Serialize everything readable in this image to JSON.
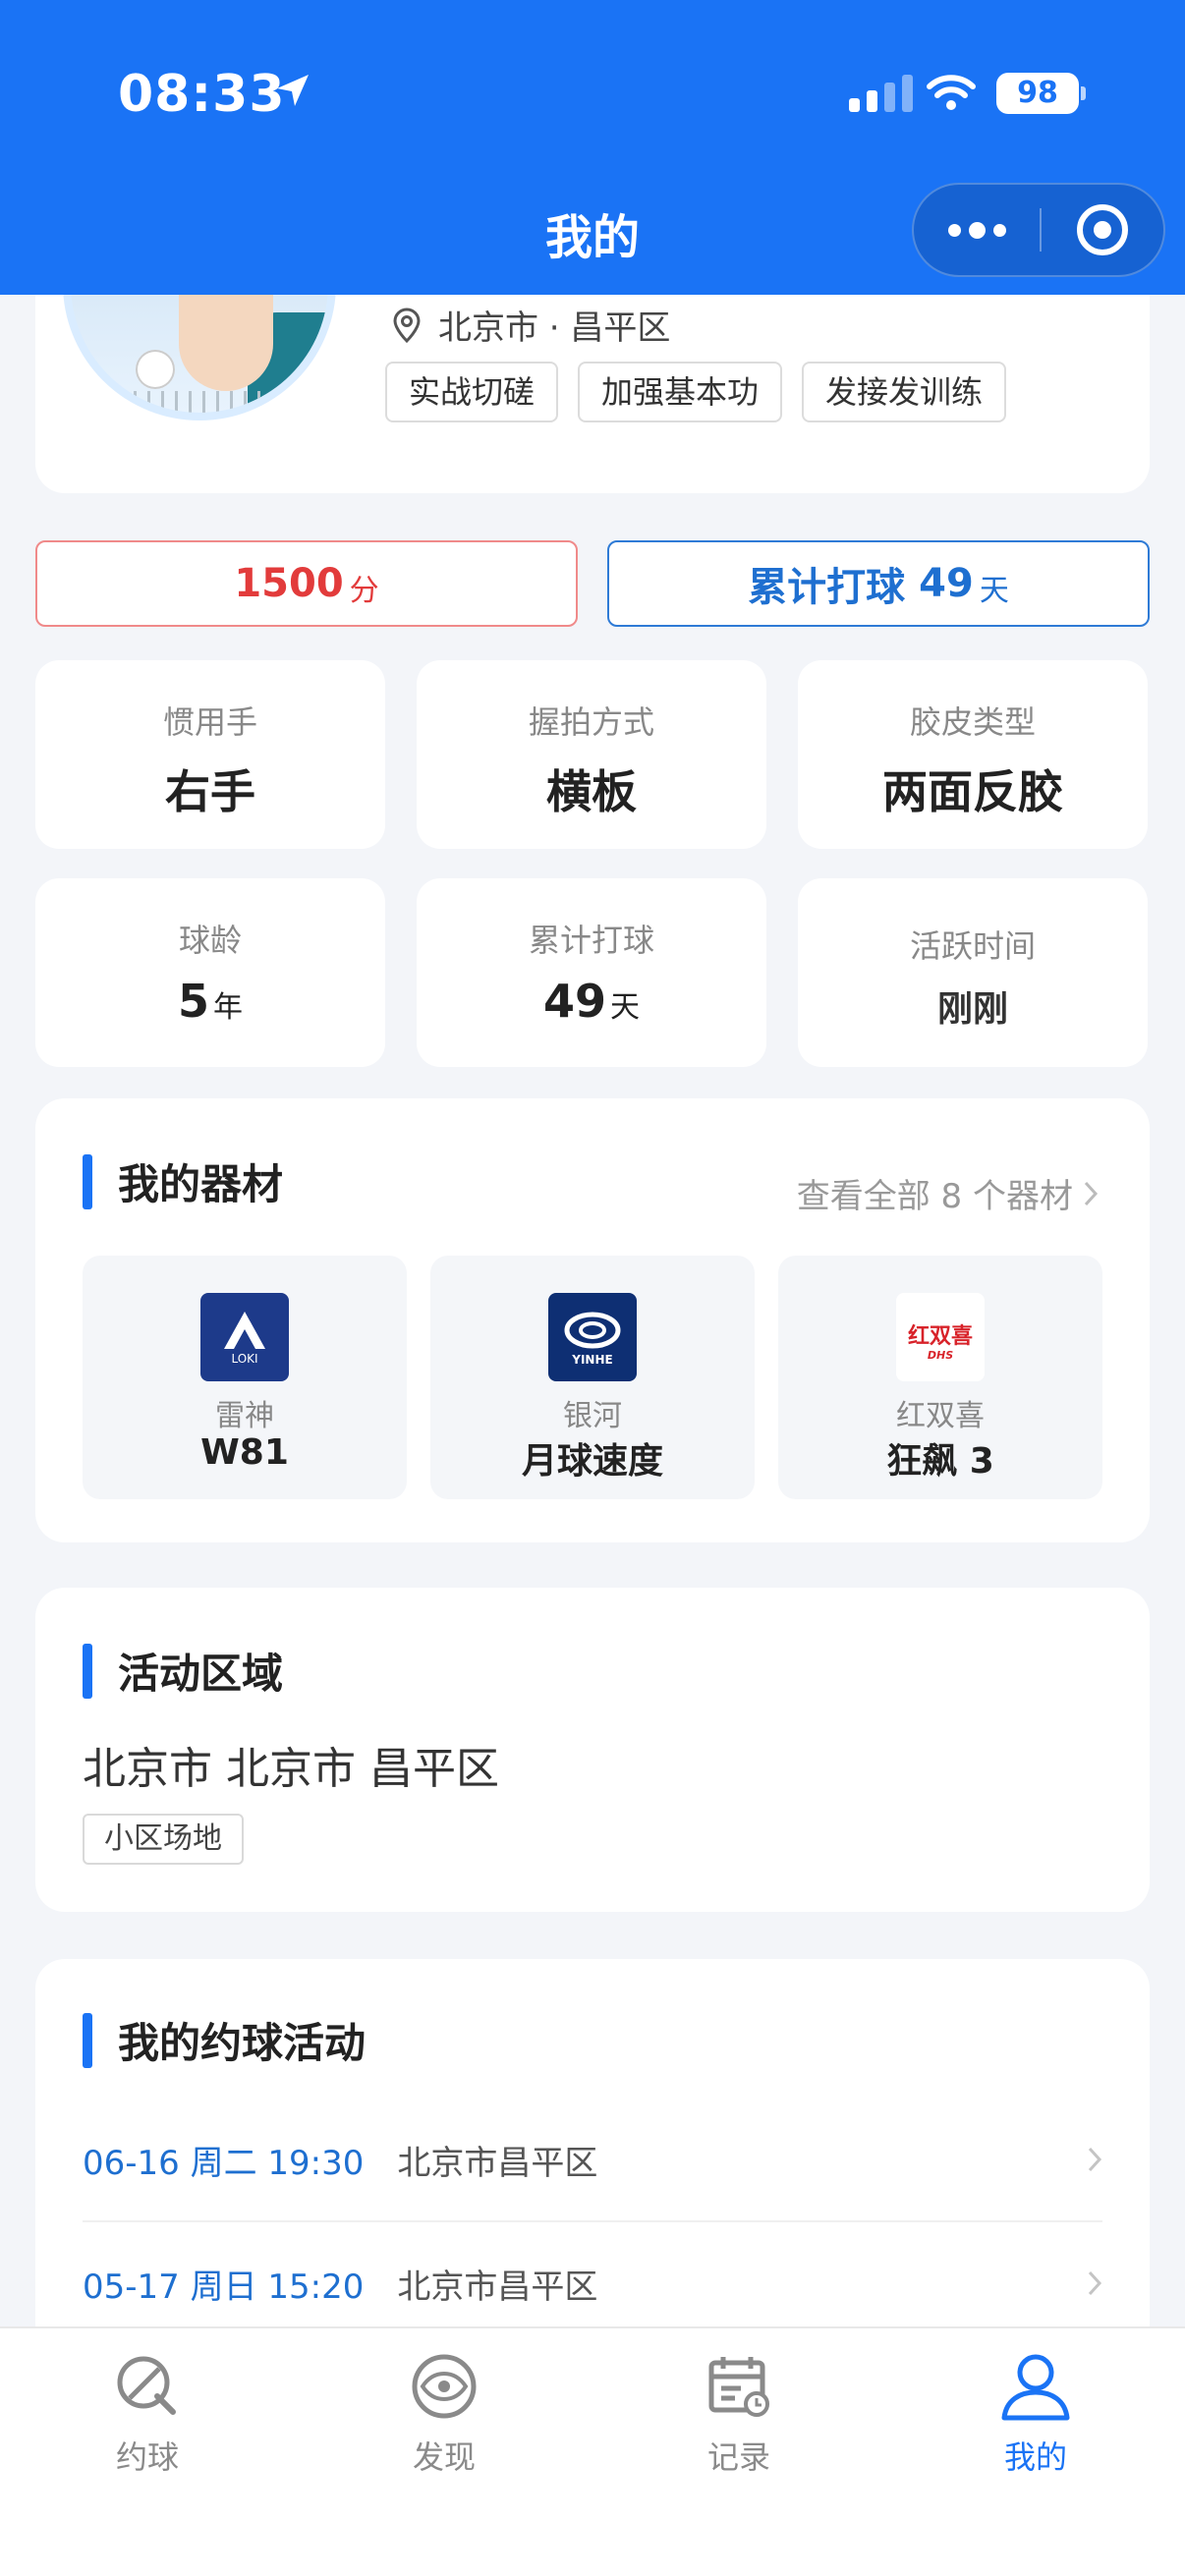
{
  "status_bar": {
    "time": "08:33",
    "battery": "98"
  },
  "header": {
    "title": "我的"
  },
  "profile": {
    "location": "北京市 · 昌平区",
    "tags": [
      "实战切磋",
      "加强基本功",
      "发接发训练"
    ]
  },
  "score": {
    "value": "1500",
    "unit": "分"
  },
  "total_days": {
    "label": "累计打球",
    "value": "49",
    "unit": "天"
  },
  "stats": {
    "hand": {
      "label": "惯用手",
      "value": "右手"
    },
    "grip": {
      "label": "握拍方式",
      "value": "横板"
    },
    "rubber": {
      "label": "胶皮类型",
      "value": "两面反胶"
    },
    "years": {
      "label": "球龄",
      "value": "5",
      "unit": "年"
    },
    "days": {
      "label": "累计打球",
      "value": "49",
      "unit": "天"
    },
    "active": {
      "label": "活跃时间",
      "value": "刚刚"
    }
  },
  "equipment": {
    "title": "我的器材",
    "view_all": "查看全部 8 个器材",
    "items": [
      {
        "brand": "雷神",
        "model": "W81",
        "logo_text": "LOKI"
      },
      {
        "brand": "银河",
        "model": "月球速度",
        "logo_text": "YINHE"
      },
      {
        "brand": "红双喜",
        "model": "狂飙 3",
        "logo_text": "红双喜"
      }
    ]
  },
  "area": {
    "title": "活动区域",
    "text": "北京市 北京市 昌平区",
    "tag": "小区场地"
  },
  "activities": {
    "title": "我的约球活动",
    "items": [
      {
        "date": "06-16 周二 19:30",
        "place": "北京市昌平区"
      },
      {
        "date": "05-17 周日 15:20",
        "place": "北京市昌平区"
      }
    ]
  },
  "tabbar": {
    "items": [
      {
        "label": "约球",
        "icon": "paddle-icon"
      },
      {
        "label": "发现",
        "icon": "eye-icon"
      },
      {
        "label": "记录",
        "icon": "calendar-icon"
      },
      {
        "label": "我的",
        "icon": "user-icon"
      }
    ],
    "active_color": "#1a73f5"
  },
  "colors": {
    "primary": "#1a73f5",
    "score_red": "#e23b3b"
  }
}
